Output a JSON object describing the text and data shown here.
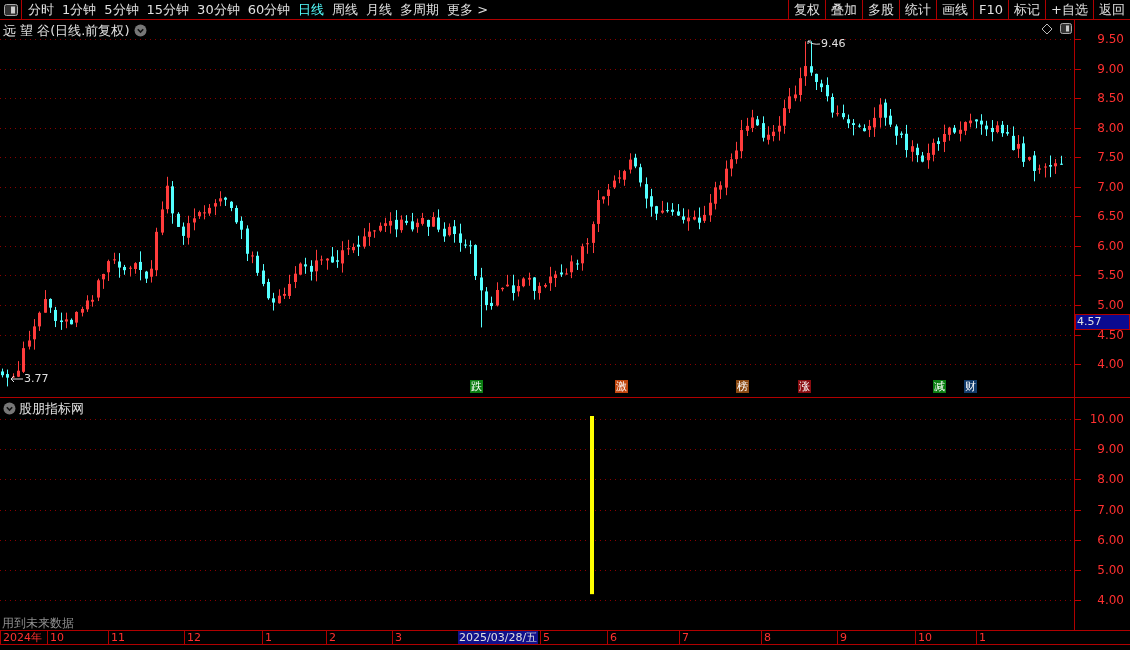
{
  "toolbar": {
    "periods": [
      {
        "label": "分时",
        "selected": false
      },
      {
        "label": "1分钟",
        "selected": false
      },
      {
        "label": "5分钟",
        "selected": false
      },
      {
        "label": "15分钟",
        "selected": false
      },
      {
        "label": "30分钟",
        "selected": false
      },
      {
        "label": "60分钟",
        "selected": false
      },
      {
        "label": "日线",
        "selected": true
      },
      {
        "label": "周线",
        "selected": false
      },
      {
        "label": "月线",
        "selected": false
      },
      {
        "label": "多周期",
        "selected": false
      }
    ],
    "more": "更多 >",
    "buttons": [
      "复权",
      "叠加",
      "多股",
      "统计",
      "画线",
      "F10",
      "标记",
      "+自选",
      "返回"
    ]
  },
  "price_pane": {
    "title": "远 望 谷(日线.前复权)",
    "high_label": "9.46",
    "low_label": "3.77",
    "axis_ticks": [
      "9.50",
      "9.00",
      "8.50",
      "8.00",
      "7.50",
      "7.00",
      "6.50",
      "6.00",
      "5.50",
      "5.00",
      "4.50",
      "4.00"
    ],
    "current_price": "4.57",
    "event_markers": [
      {
        "label": "跌",
        "color": "#0b7f12"
      },
      {
        "label": "激",
        "color": "#c2460e"
      },
      {
        "label": "榜",
        "color": "#8c4a12"
      },
      {
        "label": "涨",
        "color": "#8a0c10"
      },
      {
        "label": "减",
        "color": "#0b7f12"
      },
      {
        "label": "财",
        "color": "#123c6c"
      }
    ]
  },
  "indicator_pane": {
    "title": "股朋指标网",
    "axis_ticks": [
      "10.00",
      "9.00",
      "8.00",
      "7.00",
      "6.00",
      "5.00",
      "4.00"
    ],
    "note": "用到未来数据"
  },
  "time_axis": [
    {
      "label": "2024年",
      "highlighted": false
    },
    {
      "label": "10",
      "highlighted": false
    },
    {
      "label": "11",
      "highlighted": false
    },
    {
      "label": "12",
      "highlighted": false
    },
    {
      "label": "1",
      "highlighted": false
    },
    {
      "label": "2",
      "highlighted": false
    },
    {
      "label": "3",
      "highlighted": false
    },
    {
      "label": "2025/03/28/五",
      "highlighted": true
    },
    {
      "label": "5",
      "highlighted": false
    },
    {
      "label": "6",
      "highlighted": false
    },
    {
      "label": "7",
      "highlighted": false
    },
    {
      "label": "8",
      "highlighted": false
    },
    {
      "label": "9",
      "highlighted": false
    },
    {
      "label": "10",
      "highlighted": false
    },
    {
      "label": "1",
      "highlighted": false
    }
  ]
}
